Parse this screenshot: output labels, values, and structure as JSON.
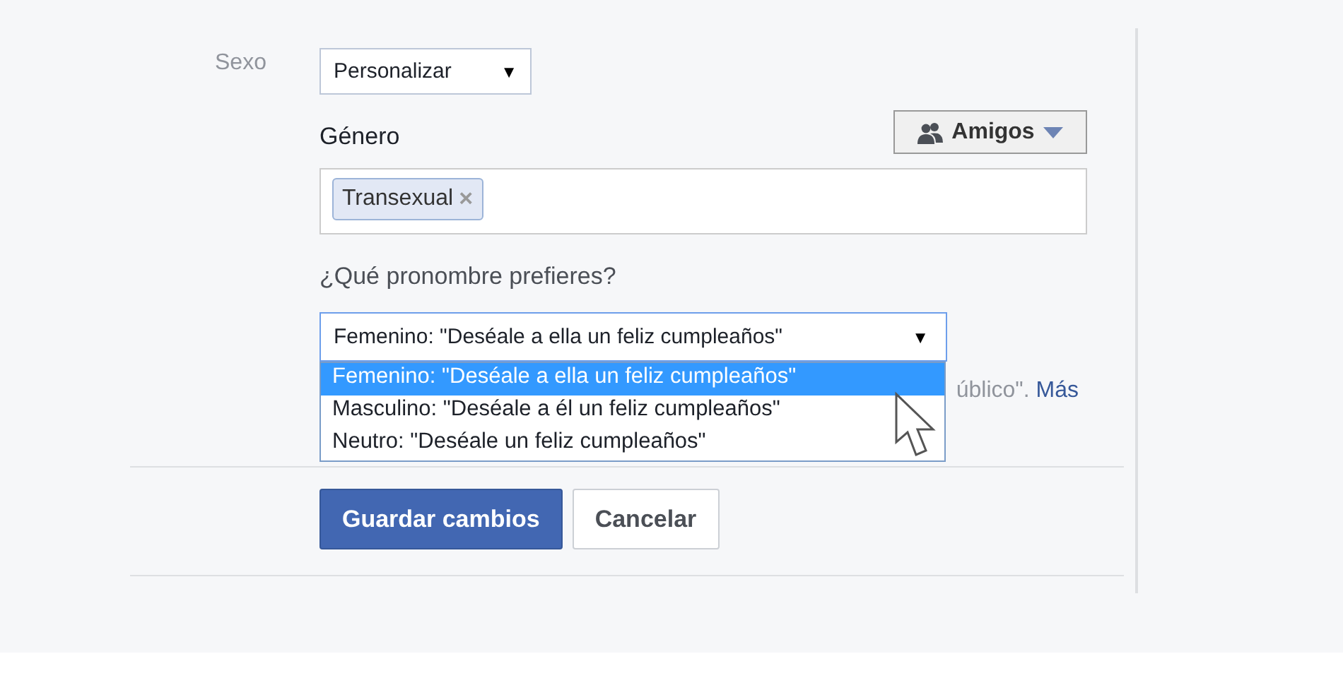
{
  "sex": {
    "label": "Sexo",
    "value": "Personalizar",
    "arrow": "▼"
  },
  "gender": {
    "label": "Género",
    "audience": {
      "label": "Amigos"
    },
    "tags": [
      {
        "label": "Transexual",
        "remove": "×"
      }
    ]
  },
  "pronoun": {
    "label": "¿Qué pronombre prefieres?",
    "value": "Femenino: \"Deséale a ella un feliz cumpleaños\"",
    "arrow": "▼",
    "expanded": true,
    "options": [
      {
        "label": "Femenino: \"Deséale a ella un feliz cumpleaños\"",
        "selected": true
      },
      {
        "label": "Masculino: \"Deséale a él un feliz cumpleaños\"",
        "selected": false
      },
      {
        "label": "Neutro: \"Deséale un feliz cumpleaños\"",
        "selected": false
      }
    ],
    "hint": "úblico\".",
    "link": "Más"
  },
  "buttons": [
    {
      "label": "Guardar cambios",
      "kind": "primary"
    },
    {
      "label": "Cancelar",
      "kind": "secondary"
    }
  ]
}
